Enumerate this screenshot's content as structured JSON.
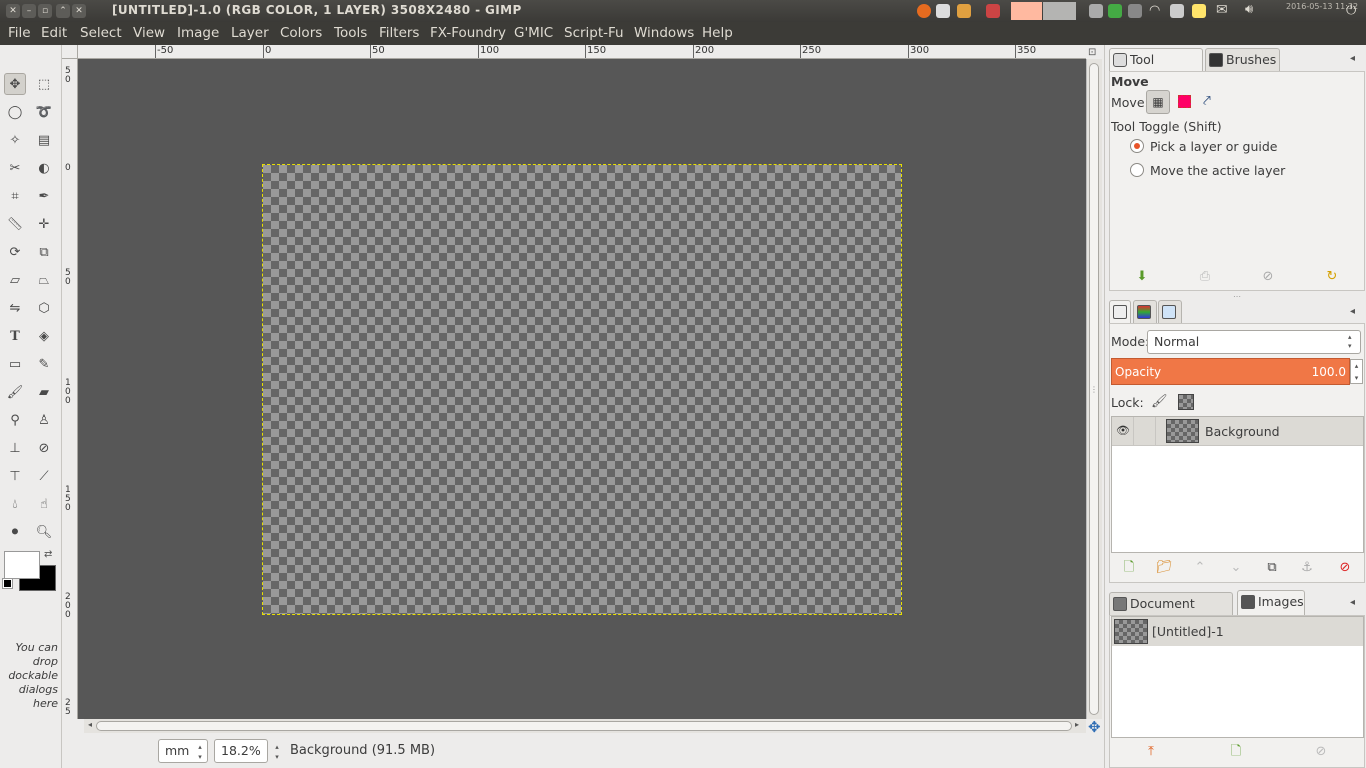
{
  "window": {
    "title": "[UNTITLED]-1.0 (RGB COLOR, 1 LAYER) 3508X2480 - GIMP",
    "clock": "2016-05-13 11:32"
  },
  "menubar": {
    "items": [
      "File",
      "Edit",
      "Select",
      "View",
      "Image",
      "Layer",
      "Colors",
      "Tools",
      "Filters",
      "FX-Foundry",
      "G'MIC",
      "Script-Fu",
      "Windows",
      "Help"
    ]
  },
  "toolbox": {
    "dock_hint": "You can drop dockable dialogs here",
    "foreground_color": "#ffffff",
    "background_color": "#000000"
  },
  "ruler": {
    "h_labels": [
      "-50",
      "0",
      "50",
      "100",
      "150",
      "200",
      "250",
      "300",
      "350"
    ],
    "v_labels": [
      "5 0",
      "0",
      "5 0",
      "1 0 0",
      "1 5 0",
      "2 0 0",
      "2 5"
    ]
  },
  "statusbar": {
    "unit": "mm",
    "zoom": "18.2%",
    "layer_info": "Background (91.5 MB)"
  },
  "tool_options": {
    "tabs": [
      "Tool Options",
      "Brushes"
    ],
    "tool_name": "Move",
    "move_label": "Move:",
    "toggle_label": "Tool Toggle  (Shift)",
    "options": [
      "Pick a layer or guide",
      "Move the active layer"
    ],
    "selected_option": 0
  },
  "layers": {
    "mode_label": "Mode:",
    "mode_value": "Normal",
    "opacity_label": "Opacity",
    "opacity_value": "100.0",
    "lock_label": "Lock:",
    "layer_name": "Background"
  },
  "images": {
    "tabs": [
      "Document History",
      "Images"
    ],
    "image_name": "[Untitled]-1"
  },
  "colors": {
    "accent": "#f07746",
    "canvas_bg": "#575757",
    "topbar_bg": "#3c3b37"
  }
}
